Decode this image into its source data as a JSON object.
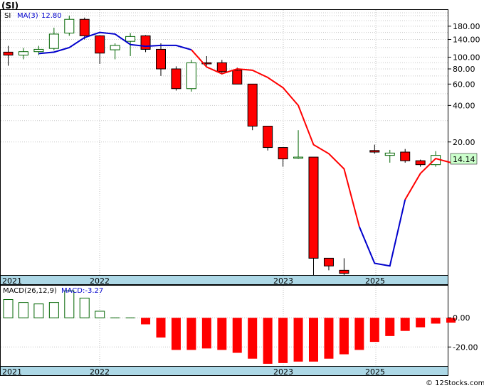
{
  "title": "(SI)",
  "footer": "© 12Stocks.com",
  "colors": {
    "up": "#006400",
    "down": "#ff0000",
    "ma_blue": "#0000cc",
    "ma_red": "#ff0000",
    "axis_band": "#add8e6",
    "last_price_box": "#ccffcc"
  },
  "chart_data": [
    {
      "type": "candlestick",
      "symbol": "SI",
      "legend": {
        "symbol": "SI",
        "ma_label": "MA(3)",
        "ma_value": "12.80"
      },
      "y_scale": "log",
      "y_ticks": [
        "180.00",
        "140.00",
        "100.00",
        "80.00",
        "60.00",
        "40.00",
        "20.00"
      ],
      "last_price_label": "14.14",
      "x_labels": [
        "2021",
        "2022",
        "2023",
        "2025"
      ],
      "candles": [
        {
          "o": 110,
          "h": 124,
          "l": 85,
          "c": 104
        },
        {
          "o": 104,
          "h": 119,
          "l": 96,
          "c": 111
        },
        {
          "o": 111,
          "h": 124,
          "l": 104,
          "c": 116
        },
        {
          "o": 118,
          "h": 175,
          "l": 114,
          "c": 155
        },
        {
          "o": 158,
          "h": 220,
          "l": 150,
          "c": 205
        },
        {
          "o": 205,
          "h": 212,
          "l": 140,
          "c": 150
        },
        {
          "o": 150,
          "h": 152,
          "l": 88,
          "c": 108
        },
        {
          "o": 115,
          "h": 130,
          "l": 96,
          "c": 125
        },
        {
          "o": 135,
          "h": 158,
          "l": 102,
          "c": 148
        },
        {
          "o": 150,
          "h": 152,
          "l": 110,
          "c": 116
        },
        {
          "o": 116,
          "h": 130,
          "l": 70,
          "c": 80
        },
        {
          "o": 80,
          "h": 84,
          "l": 53,
          "c": 55
        },
        {
          "o": 55,
          "h": 95,
          "l": 52,
          "c": 90
        },
        {
          "o": 90,
          "h": 102,
          "l": 85,
          "c": 88
        },
        {
          "o": 90,
          "h": 95,
          "l": 72,
          "c": 76
        },
        {
          "o": 78,
          "h": 82,
          "l": 60,
          "c": 60
        },
        {
          "o": 60,
          "h": 60,
          "l": 25,
          "c": 27
        },
        {
          "o": 27,
          "h": 27,
          "l": 17,
          "c": 18
        },
        {
          "o": 18,
          "h": 18,
          "l": 12.5,
          "c": 14.5
        },
        {
          "o": 15,
          "h": 25,
          "l": 14.5,
          "c": 15
        },
        {
          "o": 15,
          "h": 15,
          "l": 1.6,
          "c": 2.2
        },
        {
          "o": 2.2,
          "h": 2.2,
          "l": 1.75,
          "c": 1.9
        },
        {
          "o": 1.75,
          "h": 2.2,
          "l": 1.6,
          "c": 1.65
        },
        null,
        {
          "o": 17,
          "h": 19,
          "l": 16,
          "c": 16.5
        },
        {
          "o": 15.5,
          "h": 17.2,
          "l": 13.5,
          "c": 16.2
        },
        {
          "o": 16.5,
          "h": 17.5,
          "l": 13.5,
          "c": 14
        },
        {
          "o": 14,
          "h": 14.3,
          "l": 12.5,
          "c": 13
        },
        {
          "o": 13,
          "h": 16.8,
          "l": 12.5,
          "c": 15.5
        }
      ],
      "ma": [
        null,
        null,
        107,
        110,
        120,
        145,
        160,
        155,
        127,
        123,
        125,
        125,
        115,
        83,
        73,
        80,
        78,
        68,
        56,
        40,
        19,
        16,
        12,
        4,
        2,
        1.9,
        6.7,
        11.0,
        14.6,
        13.5,
        14.0
      ],
      "ma_color_segments": [
        {
          "from": 2,
          "to": 12,
          "color": "blue"
        },
        {
          "from": 12,
          "to": 23,
          "color": "red"
        },
        {
          "from": 23,
          "to": 26,
          "color": "blue"
        },
        {
          "from": 26,
          "to": 29,
          "color": "red"
        }
      ]
    },
    {
      "type": "bar",
      "legend": {
        "label": "MACD(26,12,9)",
        "value_label": "MACD:-3.27"
      },
      "y_ticks": [
        "0.00",
        "-20.00"
      ],
      "x_labels": [
        "2021",
        "2022",
        "2023",
        "2025"
      ],
      "values": [
        12.5,
        10.5,
        9.5,
        10.5,
        18.5,
        13.5,
        4.5,
        0.5,
        0.5,
        -4.5,
        -13.5,
        -22,
        -22,
        -21,
        -22,
        -24,
        -28,
        -31.5,
        -31,
        -30,
        -30,
        -28,
        -25,
        -22,
        -16.5,
        -12.5,
        -9,
        -6.5,
        -4,
        -3.3
      ]
    }
  ]
}
